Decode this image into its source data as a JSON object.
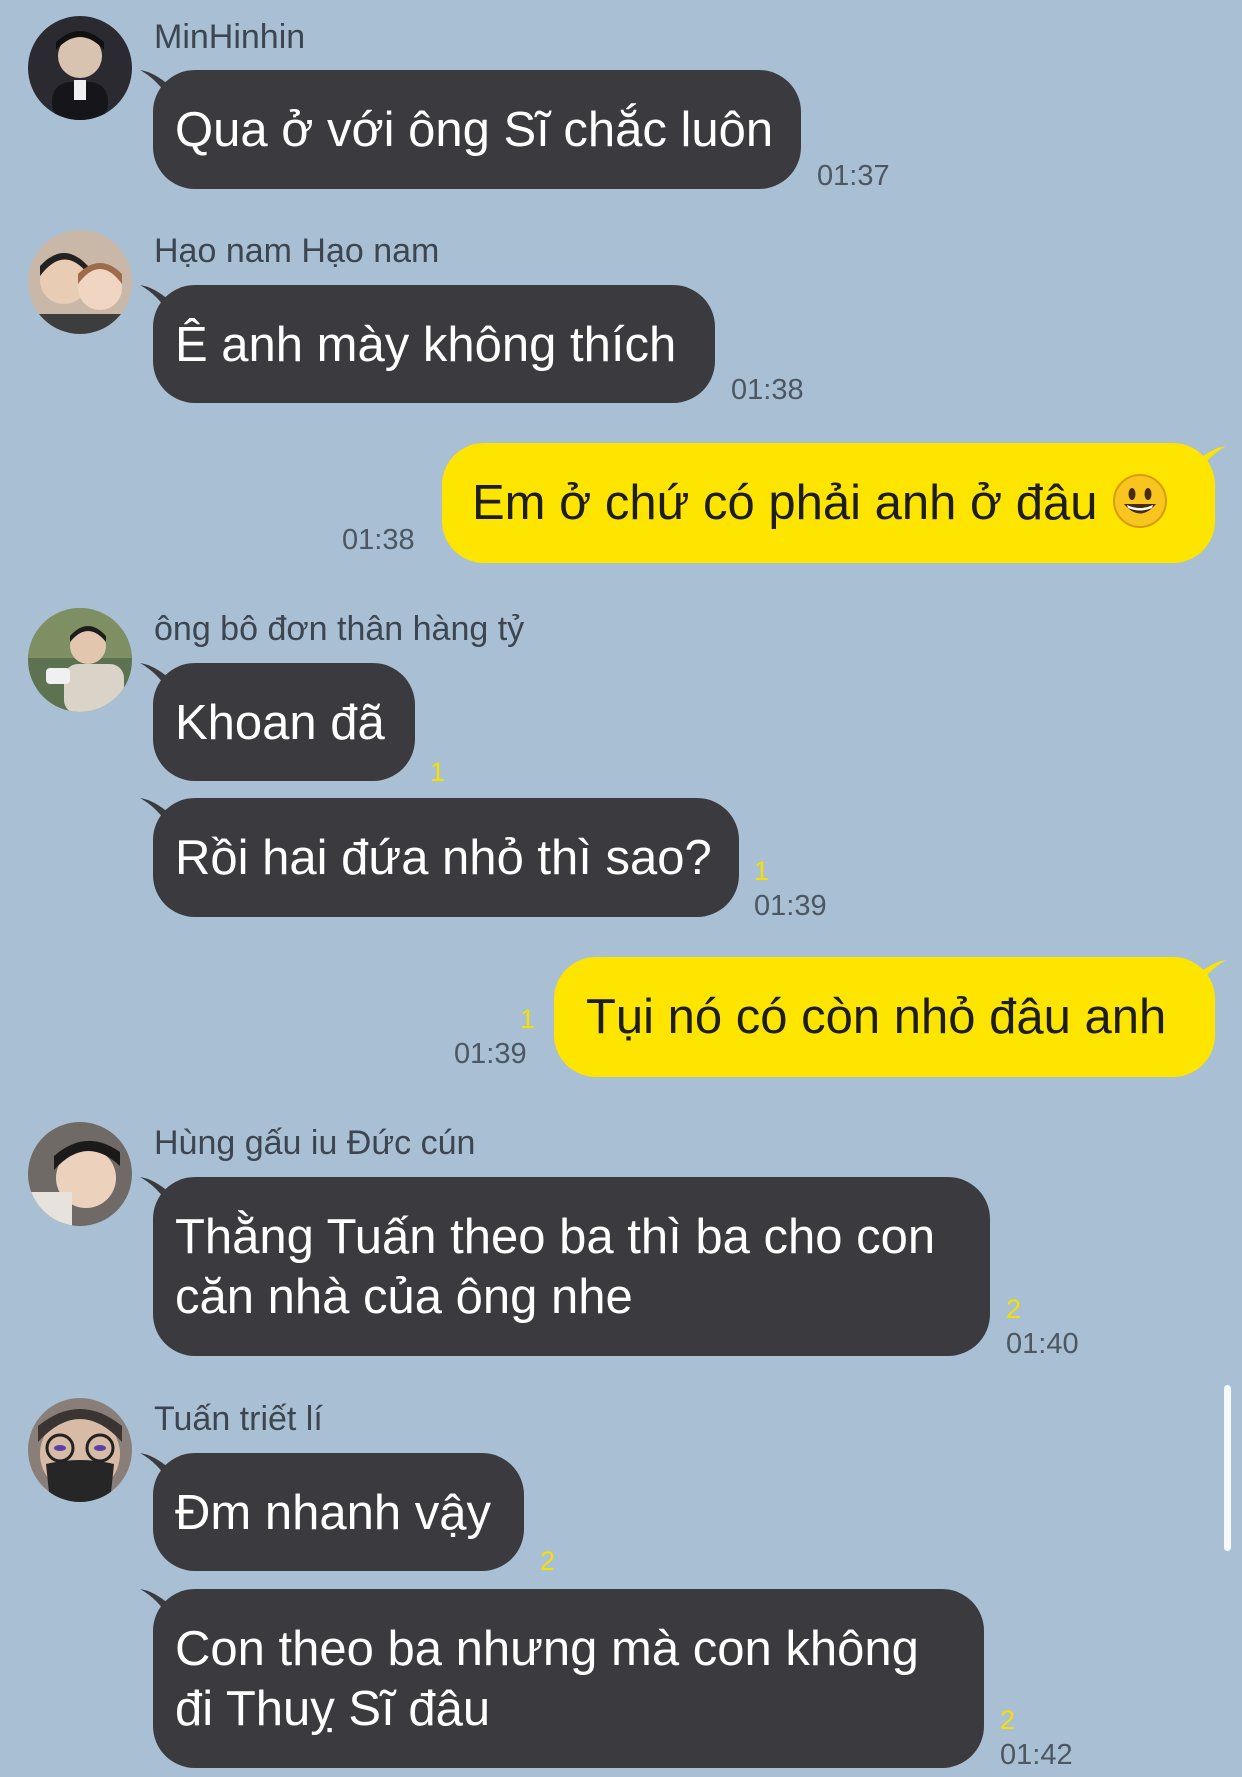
{
  "messages": [
    {
      "sender": "MinHinhin",
      "text": "Qua ở với ông Sĩ chắc luôn",
      "time": "01:37"
    },
    {
      "sender": "Hạo nam Hạo nam",
      "text": "Ê anh mày không thích",
      "time": "01:38"
    },
    {
      "text": "Em ở chứ có phải anh ở đâu",
      "time": "01:38",
      "emoji": "grinning-face"
    },
    {
      "sender": "ông bô đơn thân hàng tỷ",
      "text": "Khoan đã",
      "unread": "1"
    },
    {
      "text": "Rồi hai đứa nhỏ thì sao?",
      "unread": "1",
      "time": "01:39"
    },
    {
      "text": "Tụi nó có còn nhỏ đâu anh",
      "unread": "1",
      "time": "01:39"
    },
    {
      "sender": "Hùng gấu iu Đức cún",
      "lines": [
        "Thằng Tuấn theo ba thì ba cho con",
        "căn nhà của ông nhe"
      ],
      "unread": "2",
      "time": "01:40"
    },
    {
      "sender": "Tuấn triết lí",
      "text": "Đm nhanh vậy",
      "unread": "2"
    },
    {
      "lines": [
        "Con theo ba nhưng mà con không",
        "đi Thuỵ Sĩ đâu"
      ],
      "unread": "2",
      "time": "01:42"
    }
  ],
  "colors": {
    "background": "#a9bfd3",
    "received_bubble": "#3a3a3f",
    "sent_bubble": "#fde500",
    "unread": "#f6e000"
  }
}
